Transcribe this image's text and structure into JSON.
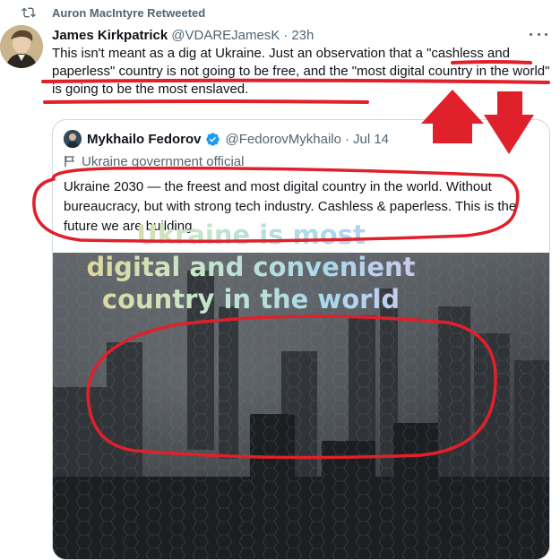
{
  "retweet": {
    "label": "Auron MacIntyre Retweeted",
    "icon": "retweet-icon"
  },
  "tweet": {
    "author_name": "James Kirkpatrick",
    "author_handle": "@VDAREJamesK",
    "separator": "·",
    "time": "23h",
    "text": "This isn't meant as a dig at Ukraine. Just an observation that a \"cashless and paperless\" country is not going to be free, and the \"most digital country in the world\" is going to be the most enslaved."
  },
  "quote": {
    "author_name": "Mykhailo Fedorov",
    "author_handle": "@FedorovMykhailo",
    "separator": "·",
    "date": "Jul 14",
    "label": "Ukraine government official",
    "text": "Ukraine 2030 — the freest and most digital country in the world. Without bureaucracy, but with strong tech industry. Cashless & paperless. This is the future we are building.",
    "media": {
      "overlay_line1": "Ukraine is most",
      "overlay_line2": "digital and convenient",
      "overlay_line3": "country in the world"
    }
  },
  "colors": {
    "accent": "#1d9bf0",
    "annotation": "#e0202a",
    "secondary_text": "#536471",
    "border": "#cfd9de"
  }
}
